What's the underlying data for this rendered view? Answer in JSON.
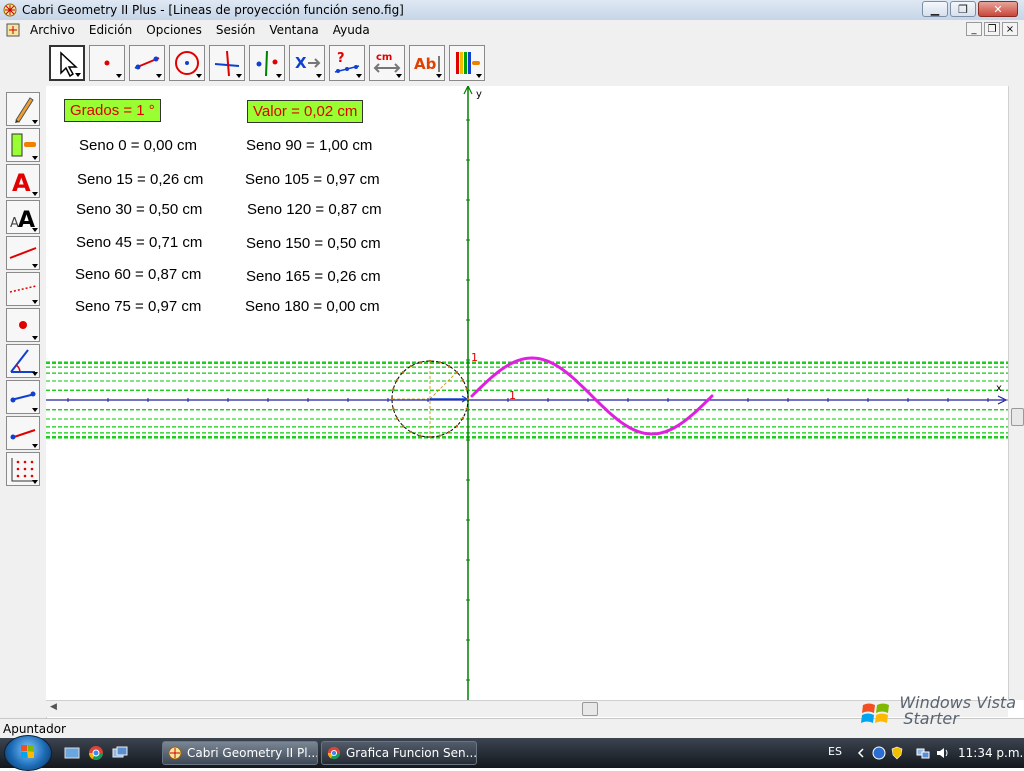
{
  "window": {
    "title": "Cabri Geometry II Plus - [Lineas de proyección función seno.fig]"
  },
  "menu": {
    "items": [
      "Archivo",
      "Edición",
      "Opciones",
      "Sesión",
      "Ventana",
      "Ayuda"
    ]
  },
  "canvas": {
    "grados_label": "Grados = 1 °",
    "valor_label": "Valor = 0,02 cm",
    "seno_left": [
      "Seno 0 = 0,00 cm",
      "Seno 15 = 0,26 cm",
      "Seno 30 = 0,50 cm",
      "Seno 45 = 0,71 cm",
      "Seno 60 = 0,87 cm",
      "Seno 75 = 0,97 cm"
    ],
    "seno_right": [
      "Seno 90 = 1,00 cm",
      "Seno 105 = 0,97 cm",
      "Seno 120 = 0,87 cm",
      "Seno 150 = 0,50 cm",
      "Seno 165 = 0,26 cm",
      "Seno 180 = 0,00 cm"
    ],
    "axis_y_label": "y",
    "axis_x_label": "x",
    "unit_y_label": "1",
    "unit_x_label": "1",
    "colors": {
      "curve": "#e020e0",
      "yaxis": "#008000",
      "xaxis": "#2020a0",
      "projection": "#00c800",
      "label_box": "#99ff33",
      "label_text": "#e00000"
    }
  },
  "status": {
    "text": "Apuntador"
  },
  "watermark": {
    "line1": "Windows Vista",
    "line2": "Starter"
  },
  "taskbar": {
    "tasks": [
      "Cabri Geometry II Pl...",
      "Grafica Funcion Sen..."
    ],
    "lang": "ES",
    "clock": "11:34 p.m."
  }
}
